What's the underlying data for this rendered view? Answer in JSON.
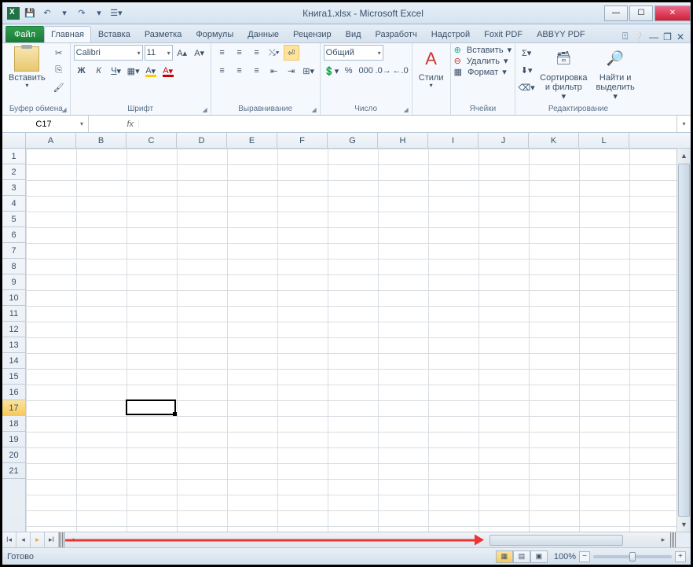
{
  "title": "Книга1.xlsx - Microsoft Excel",
  "qat": {
    "save": "💾",
    "undo": "↶",
    "redo": "↷",
    "more1": "▾",
    "more2": "▾"
  },
  "tabs": {
    "file": "Файл",
    "items": [
      "Главная",
      "Вставка",
      "Разметка",
      "Формулы",
      "Данные",
      "Рецензир",
      "Вид",
      "Разработч",
      "Надстрой",
      "Foxit PDF",
      "ABBYY PDF"
    ],
    "active": 0
  },
  "ribbon": {
    "clipboard": {
      "paste": "Вставить",
      "label": "Буфер обмена"
    },
    "font": {
      "name": "Calibri",
      "size": "11",
      "bold": "Ж",
      "italic": "К",
      "underline": "Ч",
      "label": "Шрифт"
    },
    "align": {
      "label": "Выравнивание"
    },
    "number": {
      "format": "Общий",
      "label": "Число"
    },
    "styles": {
      "btn": "Стили",
      "label": ""
    },
    "cells": {
      "insert": "Вставить",
      "delete": "Удалить",
      "format": "Формат",
      "label": "Ячейки"
    },
    "editing": {
      "sort": "Сортировка\nи фильтр",
      "find": "Найти и\nвыделить",
      "label": "Редактирование"
    }
  },
  "namebox": "C17",
  "fx": "fx",
  "columns": [
    "A",
    "B",
    "C",
    "D",
    "E",
    "F",
    "G",
    "H",
    "I",
    "J",
    "K",
    "L"
  ],
  "rows": [
    1,
    2,
    3,
    4,
    5,
    6,
    7,
    8,
    9,
    10,
    11,
    12,
    13,
    14,
    15,
    16,
    17,
    18,
    19,
    20,
    21
  ],
  "selected_row": 17,
  "selected_col_index": 2,
  "status": "Готово",
  "zoom": "100%"
}
